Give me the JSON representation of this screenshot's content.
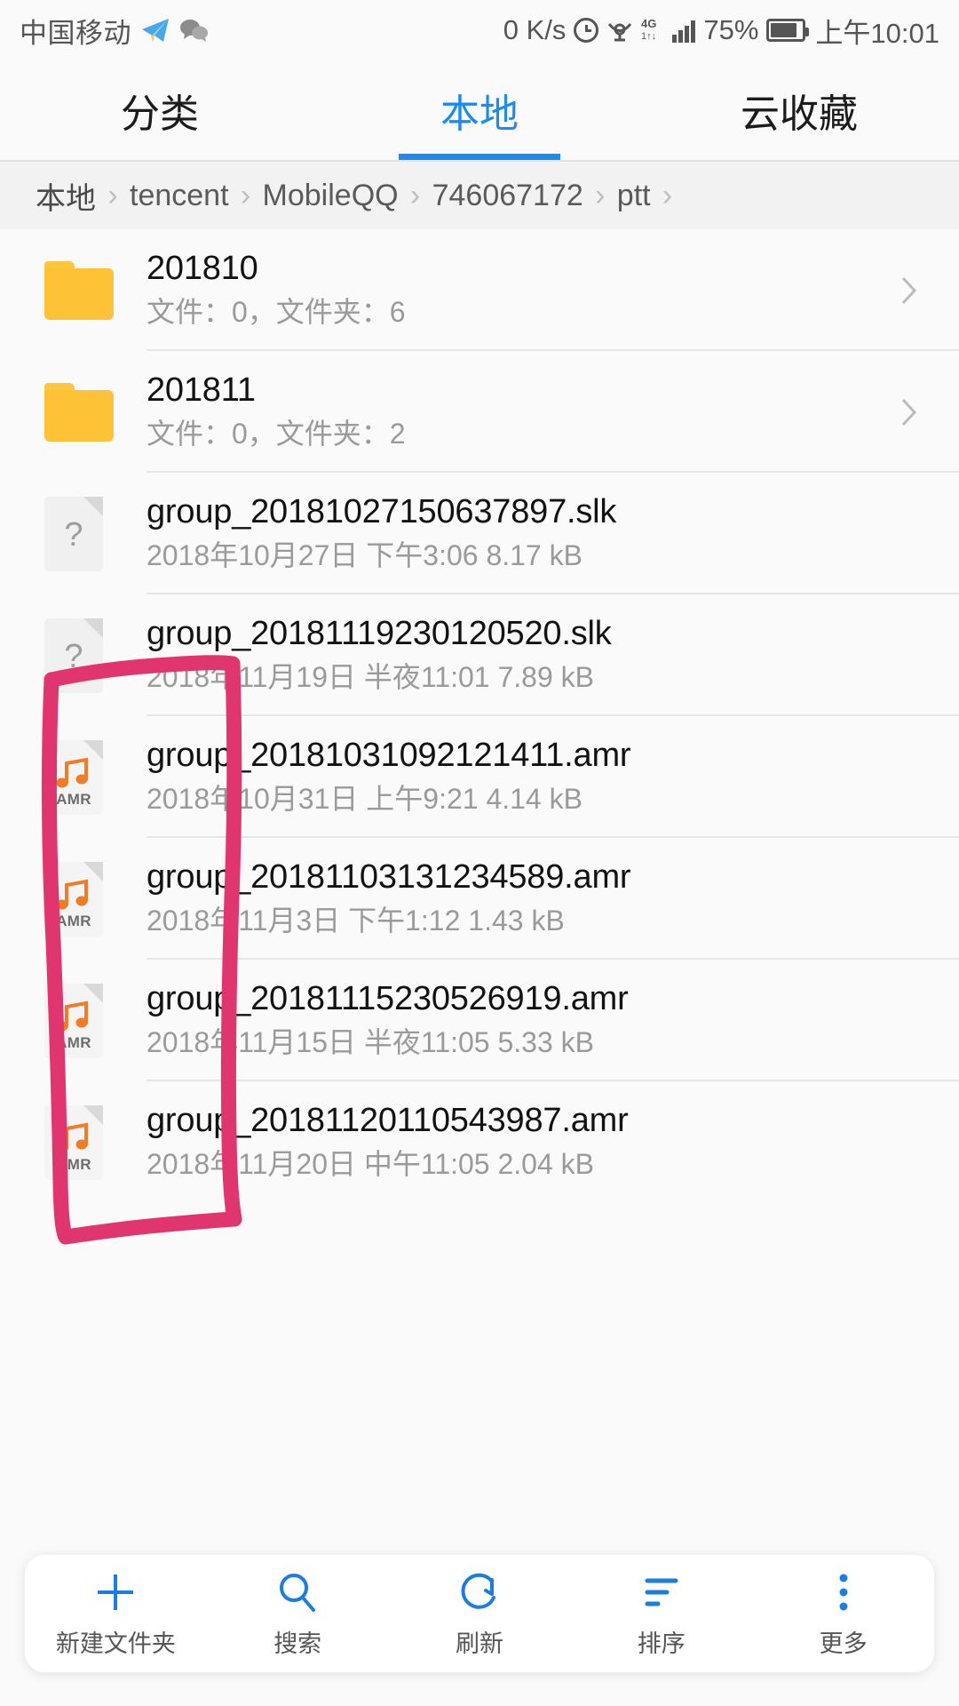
{
  "statusbar": {
    "carrier": "中国移动",
    "icons": [
      "telegram-icon",
      "wechat-icon"
    ],
    "network_speed": "0 K/s",
    "alarm_icon": "alarm-icon",
    "eye_icon": "eye-care-icon",
    "network_type": "4G",
    "signal_icon": "signal-bars-icon",
    "battery_percent": "75%",
    "battery_icon": "battery-icon",
    "time": "上午10:01"
  },
  "tabs": [
    {
      "label": "分类",
      "active": false
    },
    {
      "label": "本地",
      "active": true
    },
    {
      "label": "云收藏",
      "active": false
    }
  ],
  "breadcrumb": {
    "separator": "›",
    "items": [
      "本地",
      "tencent",
      "MobileQQ",
      "746067172",
      "ptt"
    ],
    "trailing_separator": "›"
  },
  "files": [
    {
      "name": "201810",
      "meta": "文件：0，文件夹：6",
      "icon": "folder-icon",
      "type": "folder",
      "chevron": true
    },
    {
      "name": "201811",
      "meta": "文件：0，文件夹：2",
      "icon": "folder-icon",
      "type": "folder",
      "chevron": true
    },
    {
      "name": "group_20181027150637897.slk",
      "meta": "2018年10月27日 下午3:06 8.17 kB",
      "icon": "unknown-file-icon",
      "type": "file",
      "chevron": false
    },
    {
      "name": "group_20181119230120520.slk",
      "meta": "2018年11月19日 半夜11:01 7.89 kB",
      "icon": "unknown-file-icon",
      "type": "file",
      "chevron": false
    },
    {
      "name": "group_20181031092121411.amr",
      "meta": "2018年10月31日 上午9:21 4.14 kB",
      "icon": "amr-audio-icon",
      "type": "file",
      "chevron": false
    },
    {
      "name": "group_20181103131234589.amr",
      "meta": "2018年11月3日 下午1:12 1.43 kB",
      "icon": "amr-audio-icon",
      "type": "file",
      "chevron": false
    },
    {
      "name": "group_20181115230526919.amr",
      "meta": "2018年11月15日 半夜11:05 5.33 kB",
      "icon": "amr-audio-icon",
      "type": "file",
      "chevron": false
    },
    {
      "name": "group_20181120110543987.amr",
      "meta": "2018年11月20日 中午11:05 2.04 kB",
      "icon": "amr-audio-icon",
      "type": "file",
      "chevron": false
    }
  ],
  "annotation": {
    "shape": "hand-drawn-rectangle",
    "color": "#e0356f"
  },
  "bottombar": [
    {
      "label": "新建文件夹",
      "icon": "plus-icon"
    },
    {
      "label": "搜索",
      "icon": "search-icon"
    },
    {
      "label": "刷新",
      "icon": "refresh-icon"
    },
    {
      "label": "排序",
      "icon": "sort-icon"
    },
    {
      "label": "更多",
      "icon": "more-vertical-icon"
    }
  ],
  "colors": {
    "accent": "#1a8cf0",
    "folder": "#fdc236",
    "annotation": "#e0356f",
    "amr_note": "#f07c26"
  }
}
